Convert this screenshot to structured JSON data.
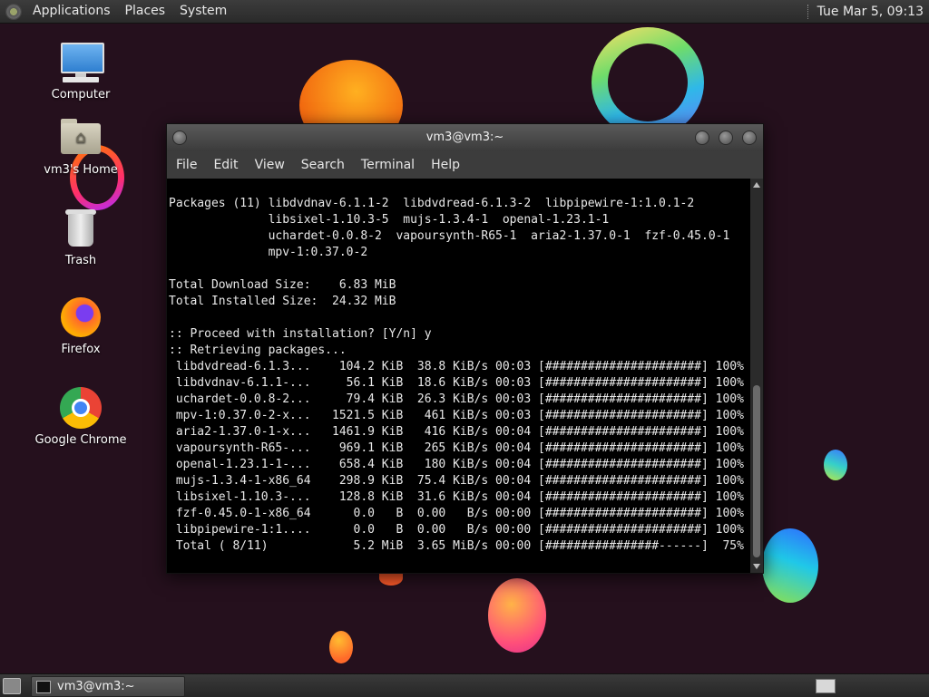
{
  "top_panel": {
    "menus": [
      "Applications",
      "Places",
      "System"
    ],
    "clock": "Tue Mar  5, 09:13"
  },
  "desktop_icons": [
    {
      "label": "Computer",
      "icon": "computer-icon"
    },
    {
      "label": "vm3's Home",
      "icon": "home-folder-icon"
    },
    {
      "label": "Trash",
      "icon": "trash-icon"
    },
    {
      "label": "Firefox",
      "icon": "firefox-icon"
    },
    {
      "label": "Google Chrome",
      "icon": "chrome-icon"
    }
  ],
  "terminal": {
    "title": "vm3@vm3:~",
    "menu": [
      "File",
      "Edit",
      "View",
      "Search",
      "Terminal",
      "Help"
    ],
    "lines": [
      "Packages (11) libdvdnav-6.1.1-2  libdvdread-6.1.3-2  libpipewire-1:1.0.1-2",
      "              libsixel-1.10.3-5  mujs-1.3.4-1  openal-1.23.1-1",
      "              uchardet-0.0.8-2  vapoursynth-R65-1  aria2-1.37.0-1  fzf-0.45.0-1",
      "              mpv-1:0.37.0-2",
      "",
      "Total Download Size:    6.83 MiB",
      "Total Installed Size:  24.32 MiB",
      "",
      ":: Proceed with installation? [Y/n] y",
      ":: Retrieving packages...",
      " libdvdread-6.1.3...    104.2 KiB  38.8 KiB/s 00:03 [######################] 100%",
      " libdvdnav-6.1.1-...     56.1 KiB  18.6 KiB/s 00:03 [######################] 100%",
      " uchardet-0.0.8-2...     79.4 KiB  26.3 KiB/s 00:03 [######################] 100%",
      " mpv-1:0.37.0-2-x...   1521.5 KiB   461 KiB/s 00:03 [######################] 100%",
      " aria2-1.37.0-1-x...   1461.9 KiB   416 KiB/s 00:04 [######################] 100%",
      " vapoursynth-R65-...    969.1 KiB   265 KiB/s 00:04 [######################] 100%",
      " openal-1.23.1-1-...    658.4 KiB   180 KiB/s 00:04 [######################] 100%",
      " mujs-1.3.4-1-x86_64    298.9 KiB  75.4 KiB/s 00:04 [######################] 100%",
      " libsixel-1.10.3-...    128.8 KiB  31.6 KiB/s 00:04 [######################] 100%",
      " fzf-0.45.0-1-x86_64      0.0   B  0.00   B/s 00:00 [######################] 100%",
      " libpipewire-1:1....      0.0   B  0.00   B/s 00:00 [######################] 100%",
      " Total ( 8/11)            5.2 MiB  3.65 MiB/s 00:00 [################------]  75%"
    ]
  },
  "taskbar": {
    "window_button": "vm3@vm3:~"
  }
}
